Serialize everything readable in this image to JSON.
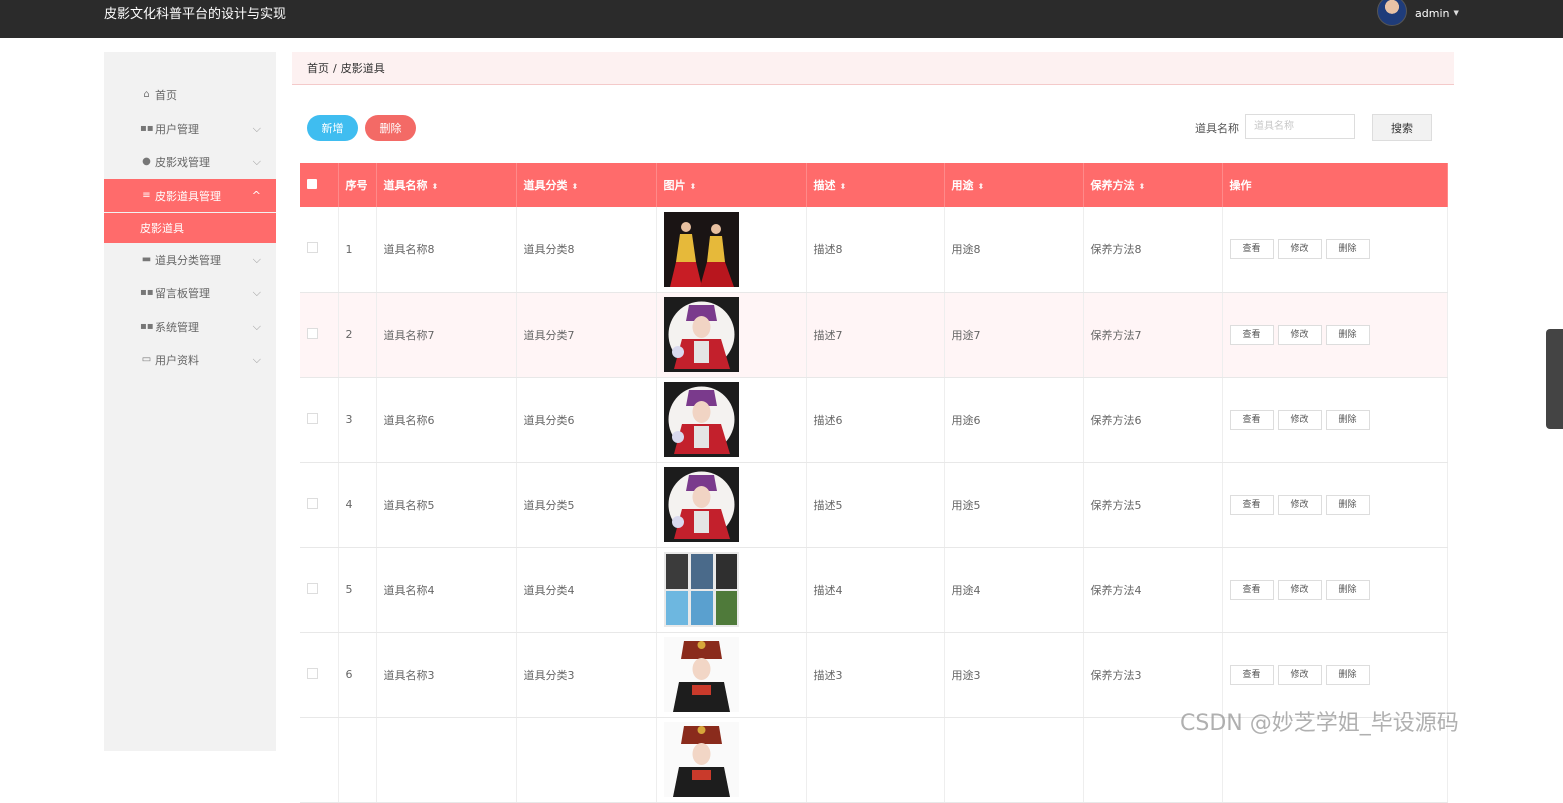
{
  "app": {
    "title": "皮影文化科普平台的设计与实现",
    "username": "admin"
  },
  "sidebar": {
    "items": [
      {
        "label": "首页",
        "icon": "home-icon",
        "glyph": "⌂",
        "expandable": false
      },
      {
        "label": "用户管理",
        "icon": "grid-icon",
        "glyph": "▪▪",
        "expandable": true
      },
      {
        "label": "皮影戏管理",
        "icon": "person-icon",
        "glyph": "●",
        "expandable": true
      },
      {
        "label": "皮影道具管理",
        "icon": "list-icon",
        "glyph": "≡",
        "expandable": true,
        "active": true
      },
      {
        "label": "道具分类管理",
        "icon": "message-icon",
        "glyph": "▬",
        "expandable": true
      },
      {
        "label": "留言板管理",
        "icon": "grid-icon",
        "glyph": "▪▪",
        "expandable": true
      },
      {
        "label": "系统管理",
        "icon": "grid-icon",
        "glyph": "▪▪",
        "expandable": true
      },
      {
        "label": "用户资料",
        "icon": "calendar-icon",
        "glyph": "▭",
        "expandable": true
      }
    ],
    "active_sub": "皮影道具"
  },
  "breadcrumb": {
    "home": "首页",
    "separator": "/",
    "current": "皮影道具"
  },
  "toolbar": {
    "add_label": "新增",
    "delete_label": "删除",
    "search_label": "道具名称",
    "search_placeholder": "道具名称",
    "search_button": "搜索"
  },
  "table": {
    "headers": [
      "序号",
      "道具名称",
      "道具分类",
      "图片",
      "描述",
      "用途",
      "保养方法",
      "操作"
    ],
    "actions": [
      "查看",
      "修改",
      "删除"
    ],
    "rows": [
      {
        "index": "1",
        "name": "道具名称8",
        "category": "道具分类8",
        "image": "costume-dancers",
        "desc": "描述8",
        "use": "用途8",
        "care": "保养方法8"
      },
      {
        "index": "2",
        "name": "道具名称7",
        "category": "道具分类7",
        "image": "opera-portrait",
        "desc": "描述7",
        "use": "用途7",
        "care": "保养方法7"
      },
      {
        "index": "3",
        "name": "道具名称6",
        "category": "道具分类6",
        "image": "opera-portrait",
        "desc": "描述6",
        "use": "用途6",
        "care": "保养方法6"
      },
      {
        "index": "4",
        "name": "道具名称5",
        "category": "道具分类5",
        "image": "opera-portrait",
        "desc": "描述5",
        "use": "用途5",
        "care": "保养方法5"
      },
      {
        "index": "5",
        "name": "道具名称4",
        "category": "道具分类4",
        "image": "costume-grid",
        "desc": "描述4",
        "use": "用途4",
        "care": "保养方法4"
      },
      {
        "index": "6",
        "name": "道具名称3",
        "category": "道具分类3",
        "image": "headdress-portrait",
        "desc": "描述3",
        "use": "用途3",
        "care": "保养方法3"
      },
      {
        "index": "",
        "name": "",
        "category": "",
        "image": "headdress-portrait",
        "desc": "",
        "use": "",
        "care": ""
      }
    ]
  },
  "watermark": "CSDN @妙芝学姐_毕设源码",
  "colors": {
    "accent": "#ff6b6b",
    "add_button": "#3fbdf0",
    "delete_button": "#f36a66",
    "topbar": "#2b2b2b"
  }
}
